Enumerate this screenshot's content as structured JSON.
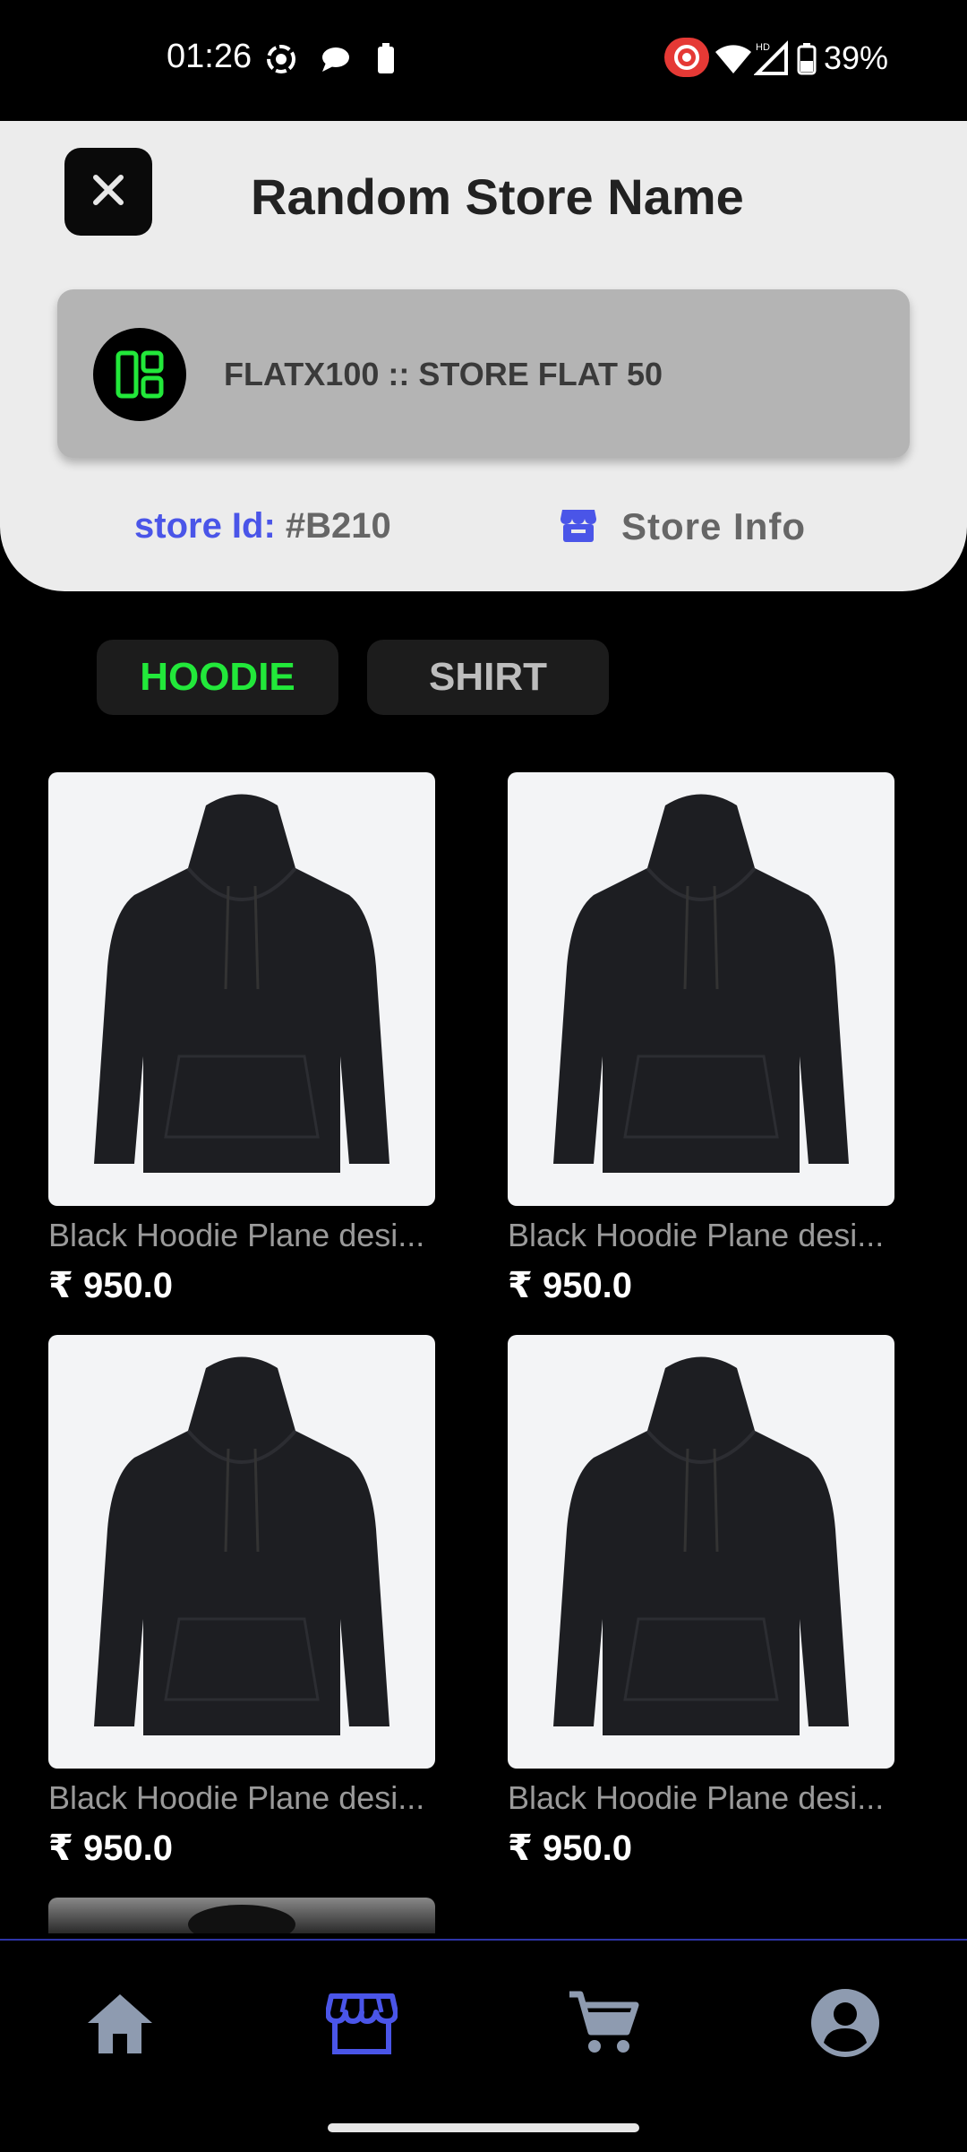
{
  "status_bar": {
    "time": "01:26",
    "battery_percent": "39%",
    "icons": [
      "screen-record-icon",
      "chat-bubble-icon",
      "battery-small-icon",
      "record-badge-icon",
      "wifi-icon",
      "signal-hd-icon",
      "battery-icon"
    ]
  },
  "header": {
    "close_icon": "close-icon",
    "store_name": "Random Store Name",
    "coupon": {
      "icon": "dashboard-layout-icon",
      "text": "FLATX100 :: STORE FLAT 50"
    },
    "store_id_label": "store Id:",
    "store_id_value": "#B210",
    "store_info_label": "Store Info",
    "store_info_icon": "storefront-icon"
  },
  "categories": [
    {
      "label": "HOODIE",
      "active": true
    },
    {
      "label": "SHIRT",
      "active": false
    }
  ],
  "products": [
    {
      "name": "Black Hoodie Plane desi...",
      "price": "₹ 950.0"
    },
    {
      "name": "Black Hoodie Plane desi...",
      "price": "₹ 950.0"
    },
    {
      "name": "Black Hoodie Plane desi...",
      "price": "₹ 950.0"
    },
    {
      "name": "Black Hoodie Plane desi...",
      "price": "₹ 950.0"
    }
  ],
  "bottom_nav": [
    {
      "icon": "home-icon",
      "active": false
    },
    {
      "icon": "store-icon",
      "active": true
    },
    {
      "icon": "cart-icon",
      "active": false
    },
    {
      "icon": "profile-icon",
      "active": false
    }
  ],
  "colors": {
    "accent": "#4a55e8",
    "active_chip": "#22e83a",
    "header_bg": "#ececec",
    "coupon_bg": "#b4b4b4"
  }
}
